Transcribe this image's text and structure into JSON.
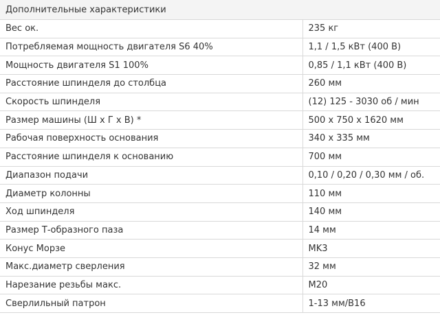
{
  "table": {
    "header": "Дополнительные характеристики",
    "rows": [
      {
        "label": "Вес ок.",
        "value": "235 кг"
      },
      {
        "label": "Потребляемая мощность двигателя S6 40%",
        "value": "1,1 / 1,5 кВт (400 В)"
      },
      {
        "label": "Мощность двигателя S1 100%",
        "value": "0,85 / 1,1 кВт (400 В)"
      },
      {
        "label": "Расстояние шпинделя до столбца",
        "value": "260 мм"
      },
      {
        "label": "Скорость шпинделя",
        "value": "(12) 125 - 3030 об / мин"
      },
      {
        "label": "Размер машины (Ш х Г х В) *",
        "value": "500 х 750 х 1620 мм"
      },
      {
        "label": "Рабочая поверхность основания",
        "value": "340 x 335 мм"
      },
      {
        "label": "Расстояние шпинделя к основанию",
        "value": "700 мм"
      },
      {
        "label": "Диапазон подачи",
        "value": "0,10 / 0,20 / 0,30 мм / об."
      },
      {
        "label": "Диаметр колонны",
        "value": "110 мм"
      },
      {
        "label": "Ход шпинделя",
        "value": "140 мм"
      },
      {
        "label": "Размер Т-образного паза",
        "value": "14 мм"
      },
      {
        "label": "Конус Морзе",
        "value": "MK3"
      },
      {
        "label": "Макс.диаметр сверления",
        "value": "32 мм"
      },
      {
        "label": "Нарезание резьбы макс.",
        "value": "M20"
      },
      {
        "label": "Сверлильный патрон",
        "value": "1-13 мм/B16"
      }
    ]
  }
}
